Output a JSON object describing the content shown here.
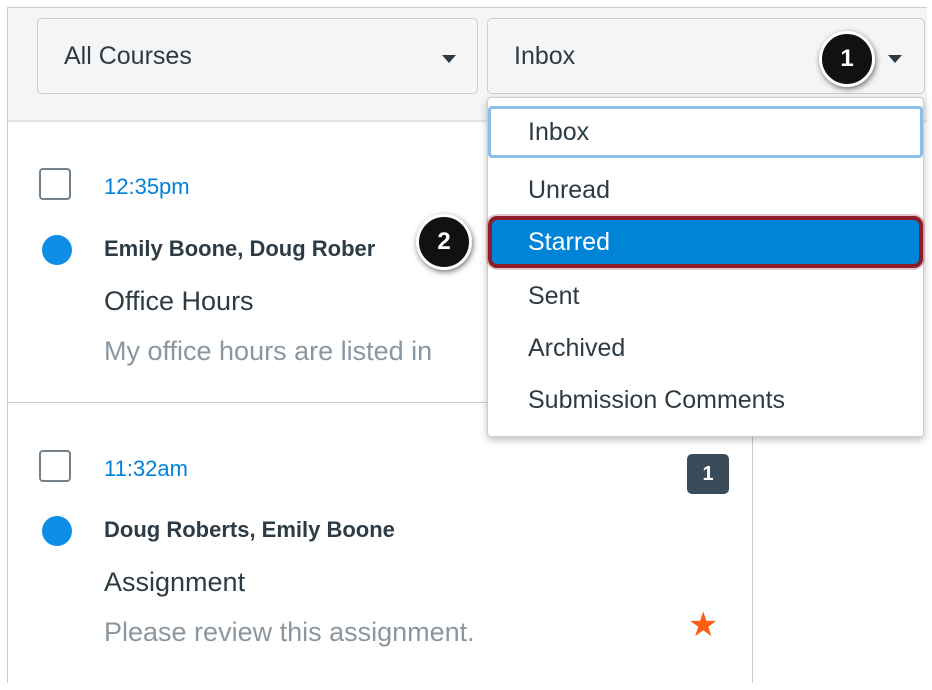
{
  "toolbar": {
    "course_filter": "All Courses",
    "mailbox_filter": "Inbox"
  },
  "dropdown": {
    "options": [
      "Inbox",
      "Unread",
      "Starred",
      "Sent",
      "Archived",
      "Submission Comments"
    ],
    "focused": "Inbox",
    "highlighted": "Starred"
  },
  "messages": [
    {
      "time": "12:35pm",
      "authors": "Emily Boone, Doug Rober",
      "subject": "Office Hours",
      "preview": "My office hours are listed in"
    },
    {
      "time": "11:32am",
      "authors": "Doug Roberts, Emily Boone",
      "subject": "Assignment",
      "preview": "Please review this assignment.",
      "count": "1",
      "starred": true
    }
  ],
  "callouts": [
    "1",
    "2"
  ],
  "colors": {
    "link": "#0081d9",
    "unread_dot": "#0f8ee8",
    "highlight": "#0084d8",
    "callout_outline": "#8b1c28",
    "star": "#fc5e13"
  }
}
